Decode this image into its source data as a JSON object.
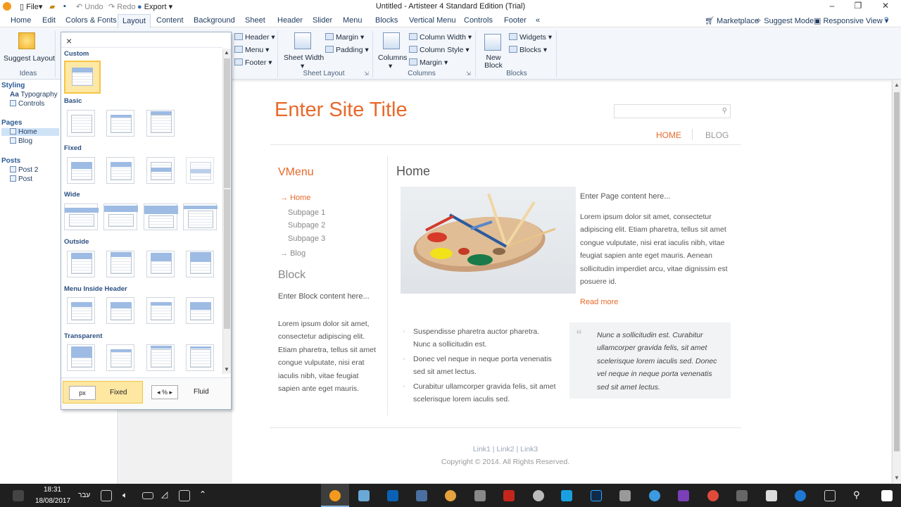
{
  "app": {
    "title": "Untitled - Artisteer 4 Standard Edition (Trial)"
  },
  "quick_access": {
    "file": "File",
    "undo": "Undo",
    "redo": "Redo",
    "export": "Export"
  },
  "menu_tabs": [
    "Home",
    "Edit",
    "Colors & Fonts",
    "Layout",
    "Content",
    "Background",
    "Sheet",
    "Header",
    "Slider",
    "Menu",
    "Blocks",
    "Vertical Menu",
    "Controls",
    "Footer",
    "«"
  ],
  "menu_right": {
    "marketplace": "Marketplace",
    "suggest": "Suggest Mode",
    "responsive": "Responsive View"
  },
  "ribbon": {
    "suggest_layout": "Suggest Layout",
    "ideas": "Ideas",
    "header": "Header",
    "menu": "Menu",
    "footer": "Footer",
    "sheet_width": "Sheet Width",
    "margin": "Margin",
    "padding": "Padding",
    "sheet_layout": "Sheet Layout",
    "columns": "Columns",
    "column_width": "Column Width",
    "column_style": "Column Style",
    "col_margin": "Margin",
    "columns_group": "Columns",
    "new_block": "New Block",
    "widgets": "Widgets",
    "blocks": "Blocks",
    "blocks_group": "Blocks"
  },
  "leftnav": {
    "styling": "Styling",
    "typography": "Typography",
    "controls": "Controls",
    "pages": "Pages",
    "home": "Home",
    "blog": "Blog",
    "posts": "Posts",
    "post2": "Post 2",
    "post": "Post"
  },
  "popup": {
    "close": "×",
    "sections": [
      "Custom",
      "Basic",
      "Fixed",
      "Wide",
      "Outside",
      "Menu Inside Header",
      "Transparent"
    ],
    "units": {
      "px": "px",
      "fixed": "Fixed",
      "percent": "%",
      "fluid": "Fluid"
    }
  },
  "site": {
    "title": "Enter Site Title",
    "nav": [
      "HOME",
      "BLOG"
    ],
    "vmenu_title": "VMenu",
    "vmenu_items": [
      "Home",
      "Subpage 1",
      "Subpage 2",
      "Subpage 3",
      "Blog"
    ],
    "block_title": "Block",
    "block_intro": "Enter Block content here...",
    "block_text": "Lorem ipsum dolor sit amet, consectetur adipiscing elit. Etiam pharetra, tellus sit amet congue vulputate, nisi erat iaculis nibh, vitae feugiat sapien ante eget mauris.",
    "page_title": "Home",
    "page_intro": "Enter Page content here...",
    "page_text": "Lorem ipsum dolor sit amet, consectetur adipiscing elit. Etiam pharetra, tellus sit amet congue vulputate, nisi erat iaculis nibh, vitae feugiat sapien ante eget mauris. Aenean sollicitudin imperdiet arcu, vitae dignissim est posuere id.",
    "read_more": "Read more",
    "bullets": [
      "Suspendisse pharetra auctor pharetra. Nunc a sollicitudin est.",
      "Donec vel neque in neque porta venenatis sed sit amet lectus.",
      "Curabitur ullamcorper gravida felis, sit amet scelerisque lorem iaculis sed."
    ],
    "quote": "Nunc a sollicitudin est. Curabitur ullamcorper gravida felis, sit amet scelerisque lorem iaculis sed. Donec vel neque in neque porta venenatis sed sit amet lectus.",
    "footer_links": "Link1 | Link2 | Link3",
    "copyright": "Copyright © 2014. All Rights Reserved."
  },
  "taskbar": {
    "time": "18:31",
    "date": "18/08/2017",
    "lang": "עבר"
  },
  "colors": {
    "accent": "#e8692a",
    "ribbon_bg": "#f3f6fb",
    "link_blue": "#2b5a92"
  }
}
